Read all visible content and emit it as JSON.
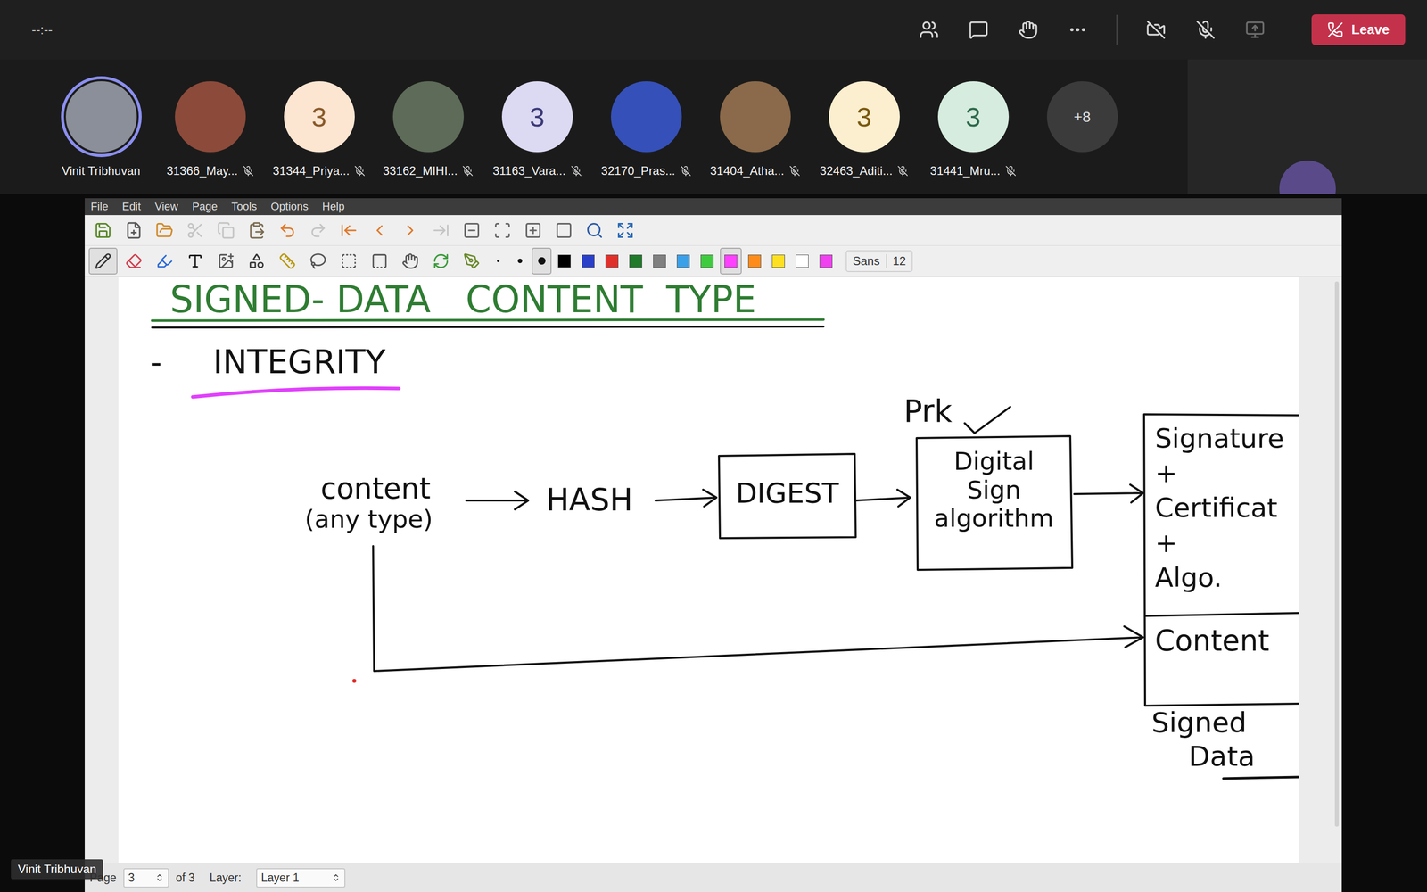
{
  "meeting_bar": {
    "timer": "--:--",
    "leave_label": "Leave",
    "camera_on": false,
    "mic_on": false,
    "share_disabled": true
  },
  "participants": [
    {
      "name": "Vinit Tribhuvan",
      "kind": "photo",
      "color": "#8a8f99",
      "speaking": true,
      "muted": false
    },
    {
      "name": "31366_May...",
      "kind": "photo",
      "color": "#8c4a3a",
      "speaking": false,
      "muted": true
    },
    {
      "name": "31344_Priya...",
      "kind": "initials",
      "initials": "3",
      "color": "#fce6d2",
      "ink": "#8a5a2b",
      "speaking": false,
      "muted": true
    },
    {
      "name": "33162_MIHI...",
      "kind": "photo",
      "color": "#5d6b58",
      "speaking": false,
      "muted": true
    },
    {
      "name": "31163_Vara...",
      "kind": "initials",
      "initials": "3",
      "color": "#dcdaf2",
      "ink": "#3c3a78",
      "speaking": false,
      "muted": true
    },
    {
      "name": "32170_Pras...",
      "kind": "photo",
      "color": "#3550b8",
      "speaking": false,
      "muted": true
    },
    {
      "name": "31404_Atha...",
      "kind": "photo",
      "color": "#8a6a4a",
      "speaking": false,
      "muted": true
    },
    {
      "name": "32463_Aditi...",
      "kind": "initials",
      "initials": "3",
      "color": "#fcefcf",
      "ink": "#7a5a10",
      "speaking": false,
      "muted": true
    },
    {
      "name": "31441_Mru...",
      "kind": "initials",
      "initials": "3",
      "color": "#d6ecdf",
      "ink": "#2d6a4a",
      "speaking": false,
      "muted": true
    }
  ],
  "overflow": "+8",
  "self_view": {
    "kind": "photo",
    "color": "#5a4a8a"
  },
  "app": {
    "menu": [
      "File",
      "Edit",
      "View",
      "Page",
      "Tools",
      "Options",
      "Help"
    ],
    "toolbar_main": [
      {
        "disabled": false
      },
      {
        "disabled": false
      },
      {
        "disabled": false
      },
      {
        "disabled": true
      },
      {
        "disabled": true
      },
      {
        "disabled": false
      },
      {
        "disabled": false
      },
      {
        "disabled": true
      },
      {
        "disabled": false
      },
      {
        "disabled": false
      },
      {
        "disabled": false
      },
      {
        "disabled": true
      },
      {
        "disabled": false
      },
      {
        "disabled": false
      },
      {
        "disabled": false
      },
      {
        "disabled": false
      },
      {
        "disabled": false
      },
      {
        "disabled": false
      }
    ],
    "toolbar_tools": [
      {
        "selected": true
      },
      {
        "selected": false
      },
      {
        "selected": false
      },
      {
        "selected": false
      },
      {
        "selected": false
      },
      {
        "selected": false
      },
      {
        "selected": false
      },
      {
        "selected": false
      },
      {
        "selected": false
      },
      {
        "selected": false
      },
      {
        "selected": false
      },
      {
        "selected": false
      },
      {
        "selected": false
      }
    ],
    "pen_sizes": [
      {
        "selected": false
      },
      {
        "selected": false
      },
      {
        "selected": true
      }
    ],
    "palette": [
      {
        "color": "#000000",
        "selected": false
      },
      {
        "color": "#2a3fc8",
        "selected": false
      },
      {
        "color": "#e0302a",
        "selected": false
      },
      {
        "color": "#1f7a2a",
        "selected": false
      },
      {
        "color": "#808080",
        "selected": false
      },
      {
        "color": "#3aa0e8",
        "selected": false
      },
      {
        "color": "#3ecb3e",
        "selected": false
      },
      {
        "color": "#ff40ff",
        "selected": true
      },
      {
        "color": "#ff8c1a",
        "selected": false
      },
      {
        "color": "#ffe020",
        "selected": false
      },
      {
        "color": "#ffffff",
        "selected": false
      },
      {
        "color": "#f040f0",
        "selected": false
      }
    ],
    "font": {
      "name": "Sans",
      "size": "12"
    },
    "status_bar": {
      "page_label": "Page",
      "page": "3",
      "of": "of 3",
      "layer_label": "Layer:",
      "layer": "Layer 1"
    }
  },
  "canvas": {
    "title": "SIGNED- DATA   CONTENT  TYPE",
    "bullet": "-",
    "heading": "INTEGRITY",
    "source": [
      "content",
      "(any type)"
    ],
    "hash": "HASH",
    "digest": "DIGEST",
    "key": "Prk",
    "signer": [
      "Digital",
      "Sign",
      "algorithm"
    ],
    "envelope_header": [
      "Signature",
      "+",
      "Certificat",
      "+",
      "Algo."
    ],
    "envelope_body": "Content",
    "caption": [
      "Signed",
      "Data"
    ]
  },
  "presenter_label": "Vinit Tribhuvan"
}
